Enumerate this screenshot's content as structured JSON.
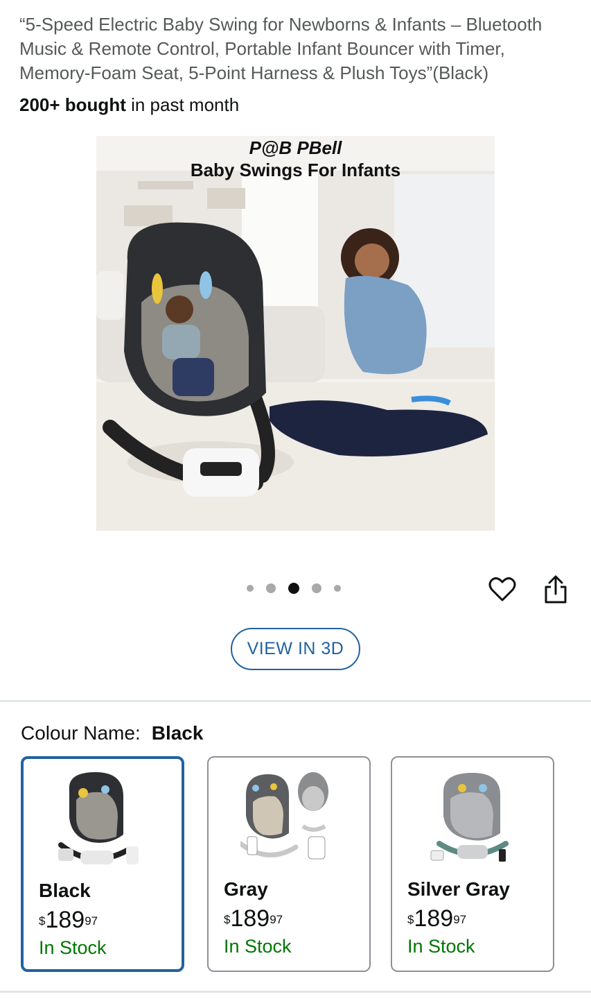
{
  "product": {
    "title": "“5-Speed Electric Baby Swing for Newborns & Infants – Bluetooth Music & Remote Control, Portable Infant Bouncer with Timer, Memory-Foam Seat, 5-Point Harness & Plush Toys”(Black)",
    "bought_count": "200+ bought",
    "bought_suffix": " in past month"
  },
  "hero_image": {
    "brand": "P@B PBell",
    "subtitle": "Baby Swings For Infants"
  },
  "carousel": {
    "total": 5,
    "active_index": 2
  },
  "actions": {
    "view3d_label": "VIEW IN 3D",
    "heart_icon": "heart-outline-icon",
    "share_icon": "share-icon"
  },
  "colour": {
    "label": "Colour Name:",
    "selected": "Black",
    "options": [
      {
        "name": "Black",
        "currency": "$",
        "price_whole": "189",
        "price_fraction": "97",
        "stock": "In Stock",
        "selected": true
      },
      {
        "name": "Gray",
        "currency": "$",
        "price_whole": "189",
        "price_fraction": "97",
        "stock": "In Stock",
        "selected": false
      },
      {
        "name": "Silver Gray",
        "currency": "$",
        "price_whole": "189",
        "price_fraction": "97",
        "stock": "In Stock",
        "selected": false
      }
    ]
  },
  "colors": {
    "link_blue": "#2162a1",
    "in_stock_green": "#007600",
    "muted_text": "#565959"
  }
}
